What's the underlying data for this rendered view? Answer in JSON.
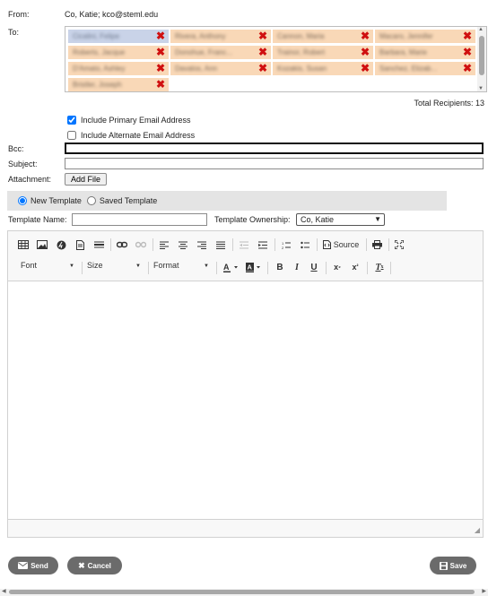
{
  "labels": {
    "from": "From:",
    "to": "To:",
    "bcc": "Bcc:",
    "subject": "Subject:",
    "attachment": "Attachment:",
    "template_name": "Template Name:",
    "template_ownership": "Template Ownership:",
    "total_recipients": "Total Recipients: 13"
  },
  "from_value": "Co, Katie; kco@steml.edu",
  "recipients": [
    "Cicalini, Felipe",
    "Rivera, Anthony",
    "Cannon, Maria",
    "Macaro, Jennifer",
    "Roberts, Jacque",
    "Donohue, Franc...",
    "Trainor, Robert",
    "Barbara, Marie",
    "D'Amato, Ashley",
    "Davalos, Ann",
    "Kozakis, Susan",
    "Sanchez, Elizab...",
    "Bristler, Joseph"
  ],
  "checkboxes": {
    "primary": "Include Primary Email Address",
    "alternate": "Include Alternate Email Address"
  },
  "attachment_button": "Add File",
  "template_options": {
    "new": "New Template",
    "saved": "Saved Template"
  },
  "ownership_selected": "Co, Katie",
  "toolbar": {
    "source": "Source",
    "font": "Font",
    "size": "Size",
    "format": "Format"
  },
  "buttons": {
    "send": "Send",
    "cancel": "Cancel",
    "save": "Save"
  },
  "colors": {
    "chip": "#f9d8b7",
    "chip_selected": "#c9d3e8",
    "remove_x": "#d01010",
    "pill_button": "#6b6b6b"
  }
}
